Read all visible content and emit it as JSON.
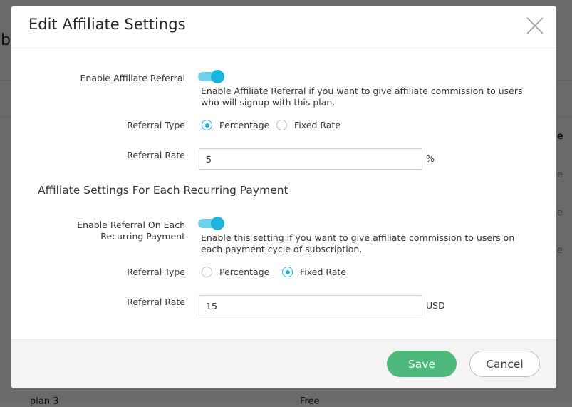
{
  "background": {
    "fragments": [
      "b",
      "e",
      "e",
      "e",
      "e",
      "plan 3",
      "Free"
    ]
  },
  "modal": {
    "title": "Edit Affiliate Settings",
    "close_icon": "close-icon",
    "affiliate": {
      "enable_label": "Enable Affiliate Referral",
      "enable_on": true,
      "help": "Enable Affiliate Referral if you want to give affiliate commission to users who will signup with this plan.",
      "type_label": "Referral Type",
      "type_options": [
        "Percentage",
        "Fixed Rate"
      ],
      "type_selected": "Percentage",
      "rate_label": "Referral Rate",
      "rate_value": "5",
      "rate_unit": "%"
    },
    "recurring": {
      "heading": "Affiliate Settings For Each Recurring Payment",
      "enable_label": "Enable Referral On Each Recurring Payment",
      "enable_on": true,
      "help": "Enable this setting if you want to give affiliate commission to users on each payment cycle of subscription.",
      "type_label": "Referral Type",
      "type_options": [
        "Percentage",
        "Fixed Rate"
      ],
      "type_selected": "Fixed Rate",
      "rate_label": "Referral Rate",
      "rate_value": "15",
      "rate_unit": "USD"
    },
    "footer": {
      "save_label": "Save",
      "cancel_label": "Cancel"
    }
  },
  "colors": {
    "accent": "#1ab4dc",
    "toggle_track": "#6dd3ea",
    "save_button": "#4cb879"
  }
}
